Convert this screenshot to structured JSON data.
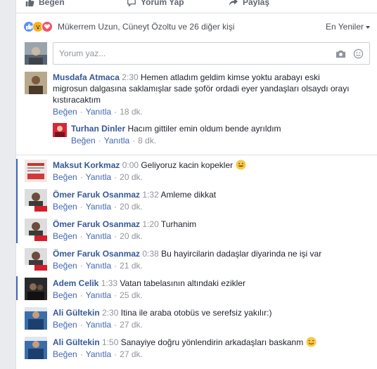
{
  "actions": {
    "like": "Beğen",
    "comment": "Yorum Yap",
    "share": "Paylaş"
  },
  "reactions": {
    "names": "Mükerrem Uzun, Cüneyt Özoltu ve 26 diğer kişi",
    "sort_label": "En Yeniler",
    "colors": {
      "like": "#5890ff",
      "wow": "#f7b125",
      "love": "#f25268"
    }
  },
  "composer": {
    "placeholder": "Yorum yaz..."
  },
  "labels": {
    "like": "Beğen",
    "reply": "Yanıtla"
  },
  "comments": [
    {
      "author": "Musdafa Atmaca",
      "ts": "2:30",
      "text": "Hemen atladım geldim kimse yoktu arabayı eski migrosun dalgasına saklamışlar sade şoför ordadi eyer yandaşları olsaydı orayı kıstıracaktım",
      "age": "18 dk."
    },
    {
      "author": "Turhan Dinler",
      "ts": "",
      "text": "Hacım gittiler emin oldum bende ayrıldım",
      "age": "8 dk."
    },
    {
      "author": "Maksut Korkmaz",
      "ts": "0:00",
      "text": "Geliyoruz kacin kopekler",
      "age": "20 dk."
    },
    {
      "author": "Ömer Faruk Osanmaz",
      "ts": "1:32",
      "text": "Amleme dikkat",
      "age": "20 dk."
    },
    {
      "author": "Ömer Faruk Osanmaz",
      "ts": "1:20",
      "text": "Turhanim",
      "age": "20 dk."
    },
    {
      "author": "Ömer Faruk Osanmaz",
      "ts": "0:38",
      "text": "Bu hayircilarin dadaşlar diyarinda ne işi var",
      "age": "21 dk."
    },
    {
      "author": "Adem Celik",
      "ts": "1:33",
      "text": "Vatan tabelasının altındaki ezikler",
      "age": "25 dk."
    },
    {
      "author": "Ali Gültekin",
      "ts": "2:30",
      "text": "Itina ile araba otobüs ve serefsiz yakılır:)",
      "age": "27 dk."
    },
    {
      "author": "Ali Gültekin",
      "ts": "1:50",
      "text": "Sanayiye doğru yönlendirin arkadaşları baskanm",
      "age": "27 dk."
    }
  ]
}
